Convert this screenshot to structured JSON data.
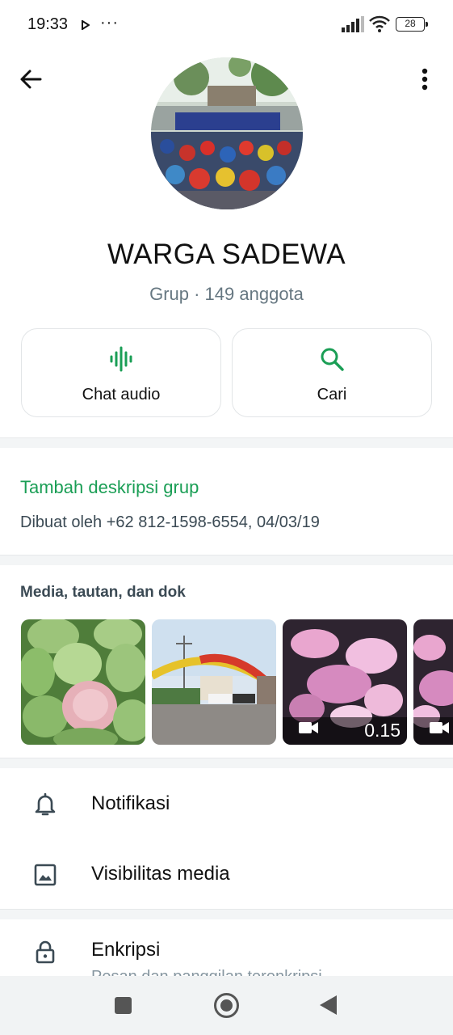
{
  "status": {
    "time": "19:33",
    "dots": "···",
    "battery": "28"
  },
  "header": {
    "back_icon": "arrow-left-icon",
    "more_icon": "more-vert-icon"
  },
  "group": {
    "name": "WARGA SADEWA",
    "meta": "Grup · 149 anggota"
  },
  "actions": [
    {
      "label": "Chat audio",
      "icon": "audio-wave-icon"
    },
    {
      "label": "Cari",
      "icon": "search-icon"
    }
  ],
  "description": {
    "add_label": "Tambah deskripsi grup",
    "created_by": "Dibuat oleh +62 812-1598-6554, 04/03/19"
  },
  "media": {
    "title": "Media, tautan, dan dok",
    "items": [
      {
        "kind": "photo",
        "icon": "photo-water-apples"
      },
      {
        "kind": "photo",
        "icon": "photo-gate"
      },
      {
        "kind": "video",
        "duration": "0.15",
        "icon": "video-camera-icon"
      },
      {
        "kind": "video",
        "icon": "video-camera-icon"
      }
    ]
  },
  "settings": [
    {
      "label": "Notifikasi",
      "icon": "bell-icon"
    },
    {
      "label": "Visibilitas media",
      "icon": "image-icon"
    },
    {
      "label": "Enkripsi",
      "icon": "lock-icon",
      "subtext": "Pesan dan panggilan terenkripsi"
    }
  ],
  "colors": {
    "accent": "#1a9e55",
    "secondary_text": "#667781"
  }
}
